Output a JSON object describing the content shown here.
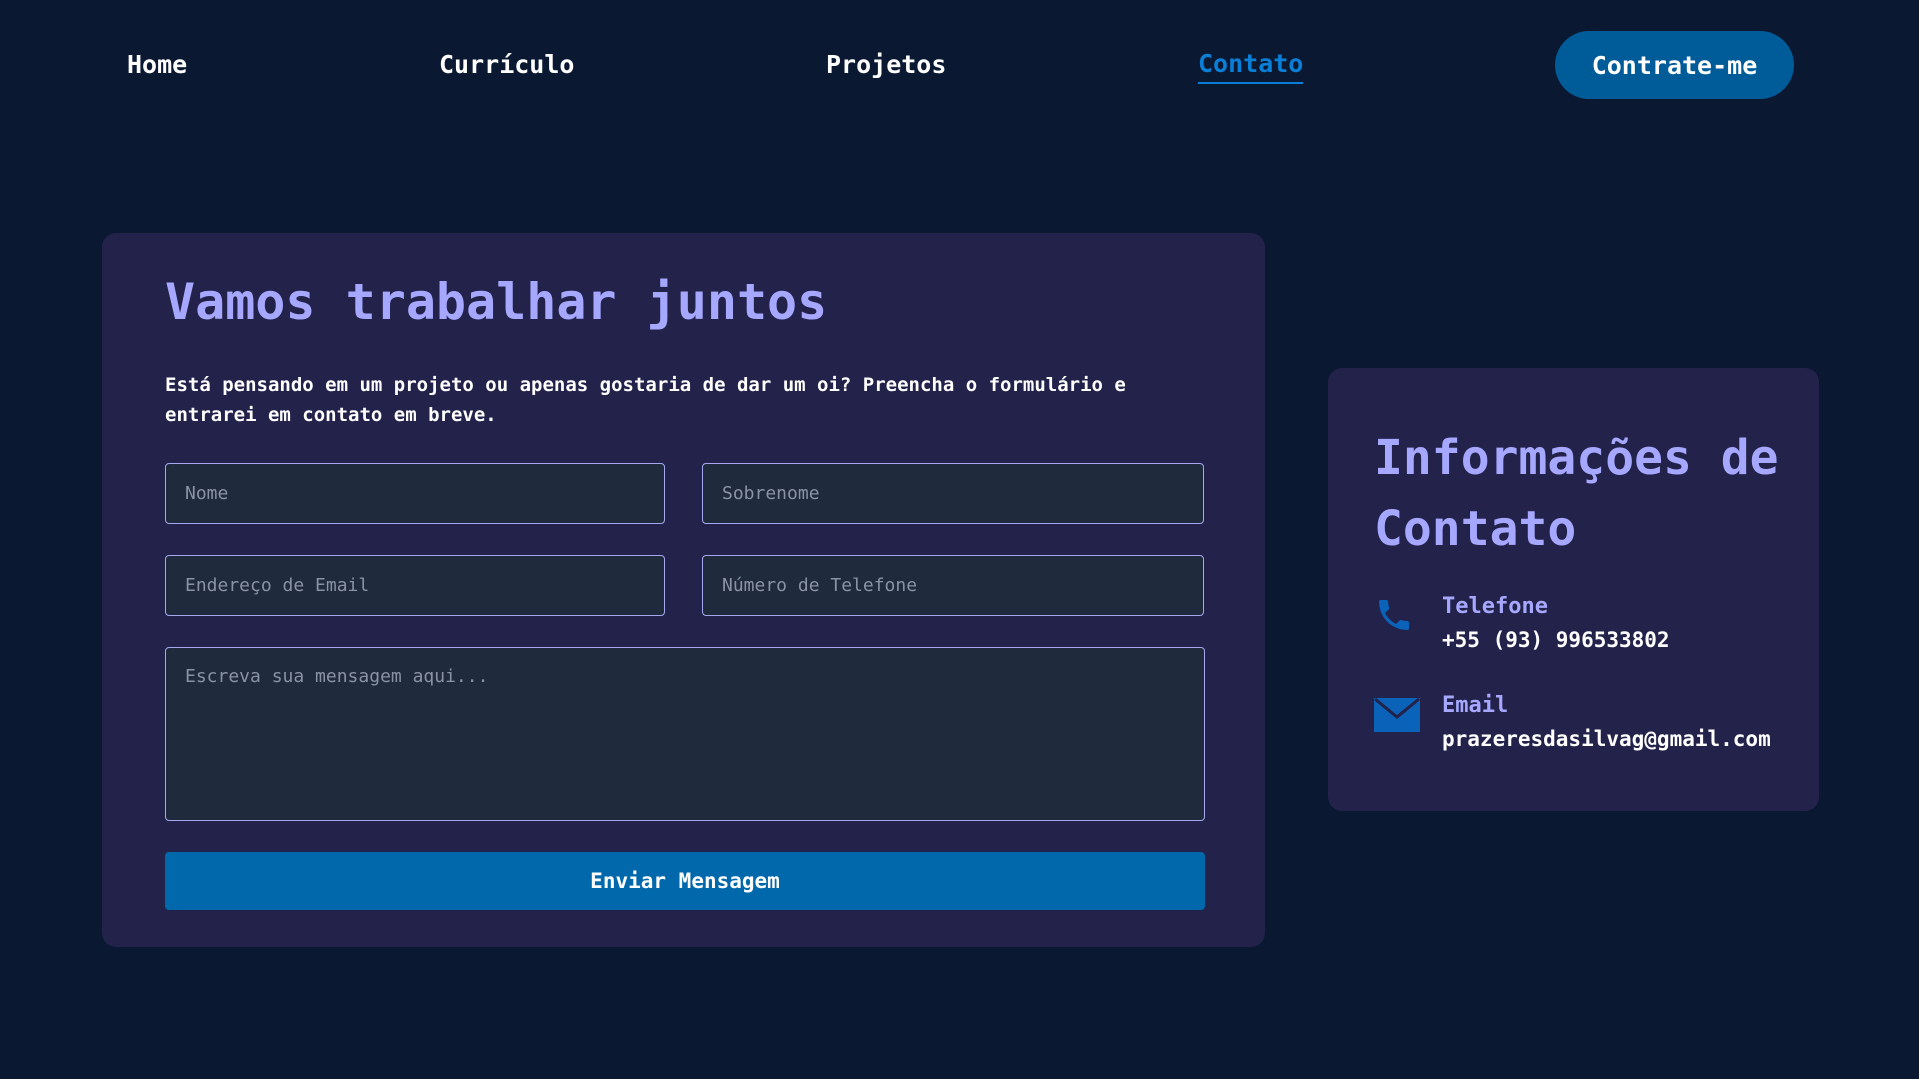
{
  "nav": {
    "items": [
      {
        "label": "Home"
      },
      {
        "label": "Currículo"
      },
      {
        "label": "Projetos"
      },
      {
        "label": "Contato"
      }
    ],
    "hire_label": "Contrate-me",
    "active_color": "#0a7fd8"
  },
  "form": {
    "title": "Vamos trabalhar juntos",
    "description": "Está pensando em um projeto ou apenas gostaria de dar um oi? Preencha o formulário e entrarei em contato em breve.",
    "first_name_placeholder": "Nome",
    "last_name_placeholder": "Sobrenome",
    "email_placeholder": "Endereço de Email",
    "phone_placeholder": "Número de Telefone",
    "message_placeholder": "Escreva sua mensagem aqui...",
    "submit_label": "Enviar Mensagem",
    "submit_color": "#0068ab"
  },
  "contact_info": {
    "title": "Informações de Contato",
    "phone": {
      "label": "Telefone",
      "value": "+55 (93) 996533802",
      "icon": "phone-icon"
    },
    "email": {
      "label": "Email",
      "value": "prazeresdasilvag@gmail.com",
      "icon": "envelope-icon"
    }
  },
  "colors": {
    "background": "#0a1931",
    "card": "#23224a",
    "accent_text": "#a6a8ff",
    "brand": "#005c99"
  }
}
